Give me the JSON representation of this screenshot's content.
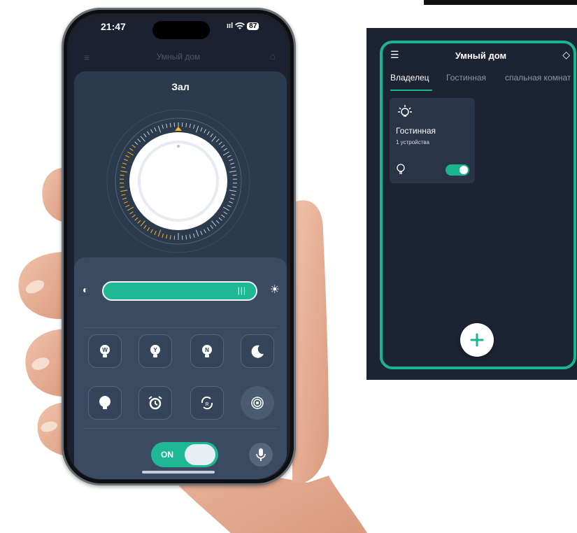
{
  "phone": {
    "status": {
      "time": "21:47",
      "signal": "ııl",
      "battery": "87"
    },
    "dim_header": {
      "title": "Умный дом"
    },
    "zone": {
      "title": "Зал",
      "brightness_percent": 100,
      "power_on": true
    },
    "icons": {
      "brightness_low": "contrast-icon",
      "brightness_high": "sun-icon",
      "buttons": [
        "bulb-w-icon",
        "bulb-y-icon",
        "bulb-n-icon",
        "moon-icon",
        "bulb-icon",
        "alarm-icon",
        "rotate-r-icon",
        "bluetooth-fingerprint-icon"
      ],
      "mic": "microphone-icon"
    },
    "toggle": {
      "label": "ON"
    }
  },
  "app": {
    "title": "Умный дом",
    "tabs": [
      "Владелец",
      "Гостинная",
      "спальная комнат"
    ],
    "active_tab": 0,
    "rooms": [
      {
        "name": "Гостинная",
        "devices": "1 устройства",
        "on": true
      }
    ],
    "accent": "#1ab58f",
    "fab_icon": "plus-icon"
  },
  "colors": {
    "accent": "#1fb894",
    "dial_marker": "#f5b623",
    "panel": "#2c3a4e"
  }
}
